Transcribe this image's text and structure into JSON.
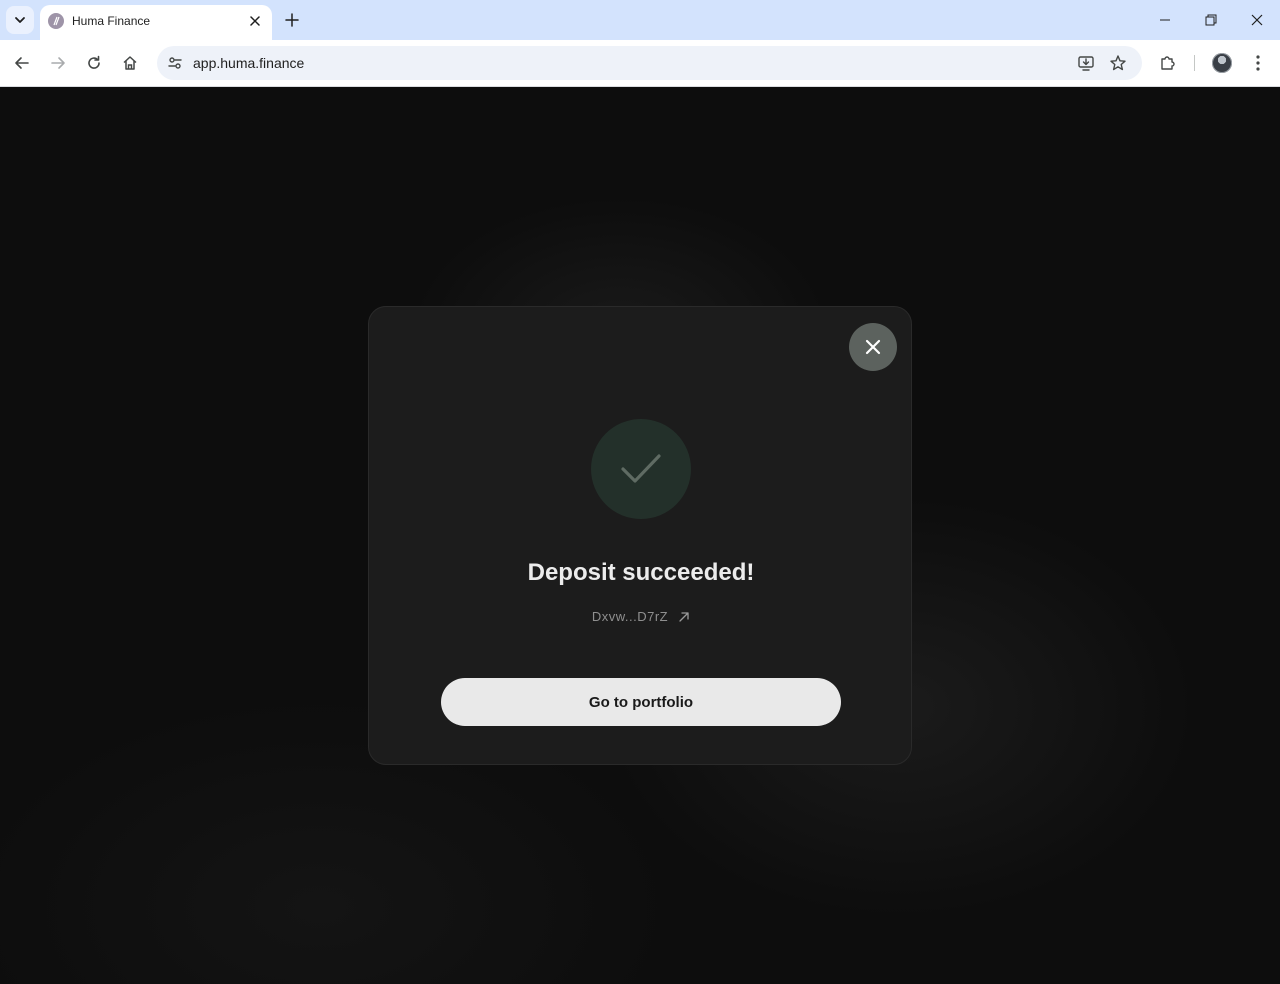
{
  "browser": {
    "tab": {
      "title": "Huma Finance"
    },
    "address_bar": {
      "url": "app.huma.finance"
    }
  },
  "modal": {
    "title": "Deposit succeeded!",
    "transaction_id": "Dxvw...D7rZ",
    "primary_button_label": "Go to portfolio"
  },
  "colors": {
    "page_background": "#0d0d0d",
    "modal_background": "#1c1c1c",
    "success_circle": "#23302a",
    "checkmark": "#5f6b63",
    "close_button": "#5c625e",
    "primary_button": "#e9e9e9"
  },
  "icons": {
    "close": "close-icon",
    "success": "checkmark-icon",
    "external_link": "external-link-arrow-icon"
  }
}
